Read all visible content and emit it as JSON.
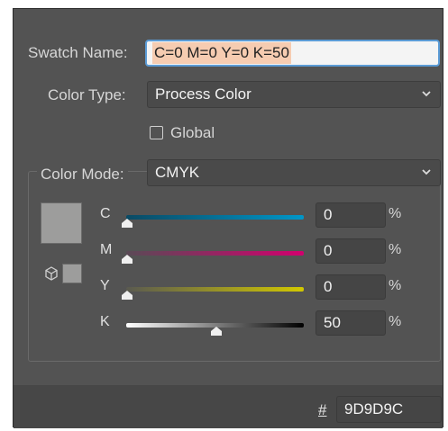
{
  "swatch_name": {
    "label": "Swatch Name:",
    "value": "C=0 M=0 Y=0 K=50"
  },
  "color_type": {
    "label": "Color Type:",
    "value": "Process Color"
  },
  "global": {
    "label": "Global",
    "checked": false
  },
  "color_mode": {
    "label": "Color Mode:",
    "value": "CMYK"
  },
  "channels": [
    {
      "name": "C",
      "value": "0",
      "unit": "%",
      "level": 0,
      "track_from": "#0a4a64",
      "track_to": "#0096c8"
    },
    {
      "name": "M",
      "value": "0",
      "unit": "%",
      "level": 0,
      "track_from": "#5a4a56",
      "track_to": "#d2006e"
    },
    {
      "name": "Y",
      "value": "0",
      "unit": "%",
      "level": 0,
      "track_from": "#5a5a50",
      "track_to": "#d2c800"
    },
    {
      "name": "K",
      "value": "50",
      "unit": "%",
      "level": 0.5,
      "track_from": "#ffffff",
      "track_to": "#000000"
    }
  ],
  "hex": {
    "symbol": "#",
    "value": "9D9D9C"
  },
  "colors": {
    "swatch": "#9d9d9c",
    "panel": "#535353",
    "selection_highlight": "#f6ccb1",
    "focus_ring": "#5b9bd5"
  },
  "icons": [
    "chevron-down-icon",
    "out-of-gamut-cube-icon"
  ]
}
